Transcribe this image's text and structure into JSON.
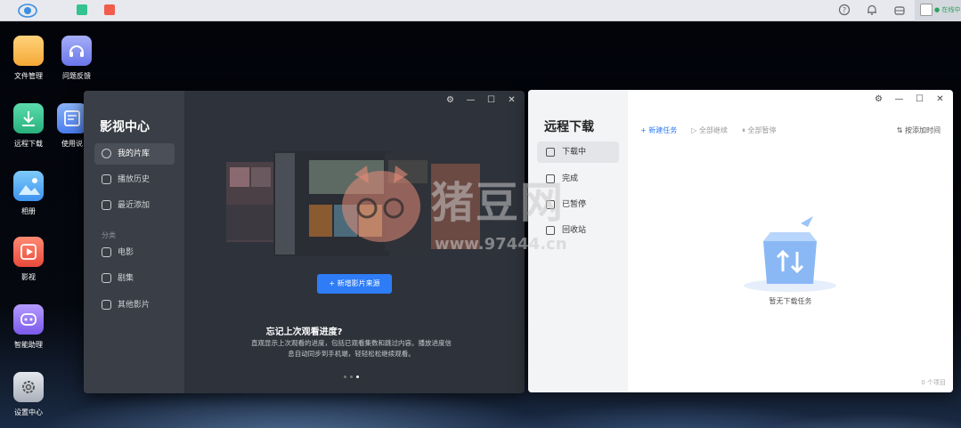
{
  "topbar": {
    "status_text": "● 在线中",
    "help_icon": "question-icon",
    "bell_icon": "bell-icon",
    "cloud_icon": "cloud-icon"
  },
  "desktop": {
    "icons": [
      {
        "label": "文件管理",
        "icon": "folder-icon",
        "color": "#f7b749"
      },
      {
        "label": "问题反馈",
        "icon": "headset-icon",
        "color": "#7b86f0"
      },
      {
        "label": "远程下载",
        "icon": "download-icon",
        "color": "#34c28f"
      },
      {
        "label": "使用说",
        "icon": "manual-icon",
        "color": "#5a8cf2"
      },
      {
        "label": "相册",
        "icon": "photo-icon",
        "color": "#4aa8f5"
      },
      {
        "label": "影视",
        "icon": "play-icon",
        "color": "#f25c4d"
      },
      {
        "label": "智能助理",
        "icon": "assistant-icon",
        "color": "#8a6cf0"
      },
      {
        "label": "设置中心",
        "icon": "gear-icon",
        "color": "#c7ccd4"
      }
    ]
  },
  "video_window": {
    "title": "影视中心",
    "nav": [
      {
        "label": "我的片库",
        "active": true
      },
      {
        "label": "播放历史",
        "active": false
      },
      {
        "label": "最近添加",
        "active": false
      }
    ],
    "section_label": "分类",
    "categories": [
      {
        "label": "电影"
      },
      {
        "label": "剧集"
      },
      {
        "label": "其他影片"
      }
    ],
    "add_source_button": "+ 新增影片来源",
    "promo_title": "忘记上次观看进度?",
    "promo_desc": "直观显示上次观看的进度，包括已观看集数和跳过内容。播放进度信息自动同步到手机端，轻轻松松继续观看。"
  },
  "download_window": {
    "title": "远程下载",
    "nav": [
      {
        "label": "下载中",
        "active": true
      },
      {
        "label": "完成",
        "active": false
      },
      {
        "label": "已暂停",
        "active": false
      },
      {
        "label": "回收站",
        "active": false
      }
    ],
    "toolbar": {
      "new_task": "+ 新建任务",
      "start_all": "▷ 全部继续",
      "pause_all": "⏸ 全部暂停",
      "sort": "⇅ 按添加时间"
    },
    "empty_text": "暂无下载任务",
    "footer": "0 个项目"
  },
  "watermark": {
    "main": "猪豆网",
    "url": "www.97444.cn"
  },
  "colors": {
    "accent": "#2e7cf6"
  }
}
